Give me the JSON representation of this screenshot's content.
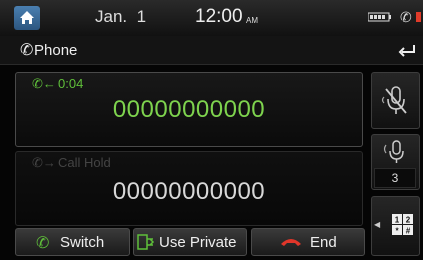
{
  "status": {
    "date": "Jan.  1",
    "time": "12:00",
    "ampm": "AM"
  },
  "title": "Phone",
  "active_call": {
    "timer": "0:04",
    "number": "00000000000",
    "color": "#7ed34e"
  },
  "held_call": {
    "label": "Call Hold",
    "number": "00000000000"
  },
  "volume": {
    "value": "3"
  },
  "buttons": {
    "switch": "Switch",
    "use_private": "Use Private",
    "end": "End"
  },
  "icons": {
    "home": "home-icon",
    "battery": "battery-icon",
    "signal": "signal-icon",
    "phone": "phone-icon",
    "back": "back-icon",
    "mute": "mic-mute-icon",
    "volume": "mic-volume-icon",
    "keypad": "keypad-icon",
    "end": "end-call-icon"
  },
  "colors": {
    "accent": "#5fbf3a",
    "end": "#e0362a",
    "home": "#3a6d9e"
  }
}
